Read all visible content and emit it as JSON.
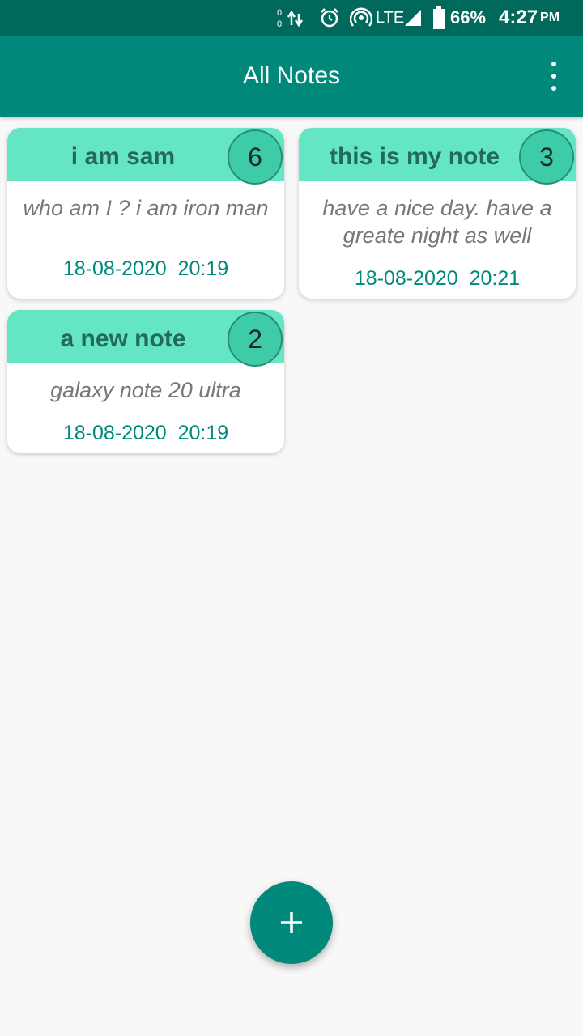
{
  "status_bar": {
    "data_counts": [
      "0",
      "0"
    ],
    "network": "LTE",
    "battery": "66%",
    "time": "4:27",
    "ampm": "PM"
  },
  "app_bar": {
    "title": "All Notes",
    "menu_icon": "overflow-menu-icon"
  },
  "notes": [
    {
      "title": "i am sam",
      "count": "6",
      "body": "who am I ? i am iron man",
      "date": "18-08-2020  20:19"
    },
    {
      "title": "this is my note",
      "count": "3",
      "body": "have a nice day. have a greate night as well",
      "date": "18-08-2020  20:21"
    },
    {
      "title": "a new note",
      "count": "2",
      "body": "galaxy note 20 ultra",
      "date": "18-08-2020  20:19"
    }
  ],
  "fab": {
    "icon": "plus-icon"
  },
  "colors": {
    "status_bar": "#00695c",
    "app_bar": "#00897b",
    "card_header": "#64e6c4",
    "count_badge": "#3dcba8",
    "date_text": "#00897b"
  }
}
